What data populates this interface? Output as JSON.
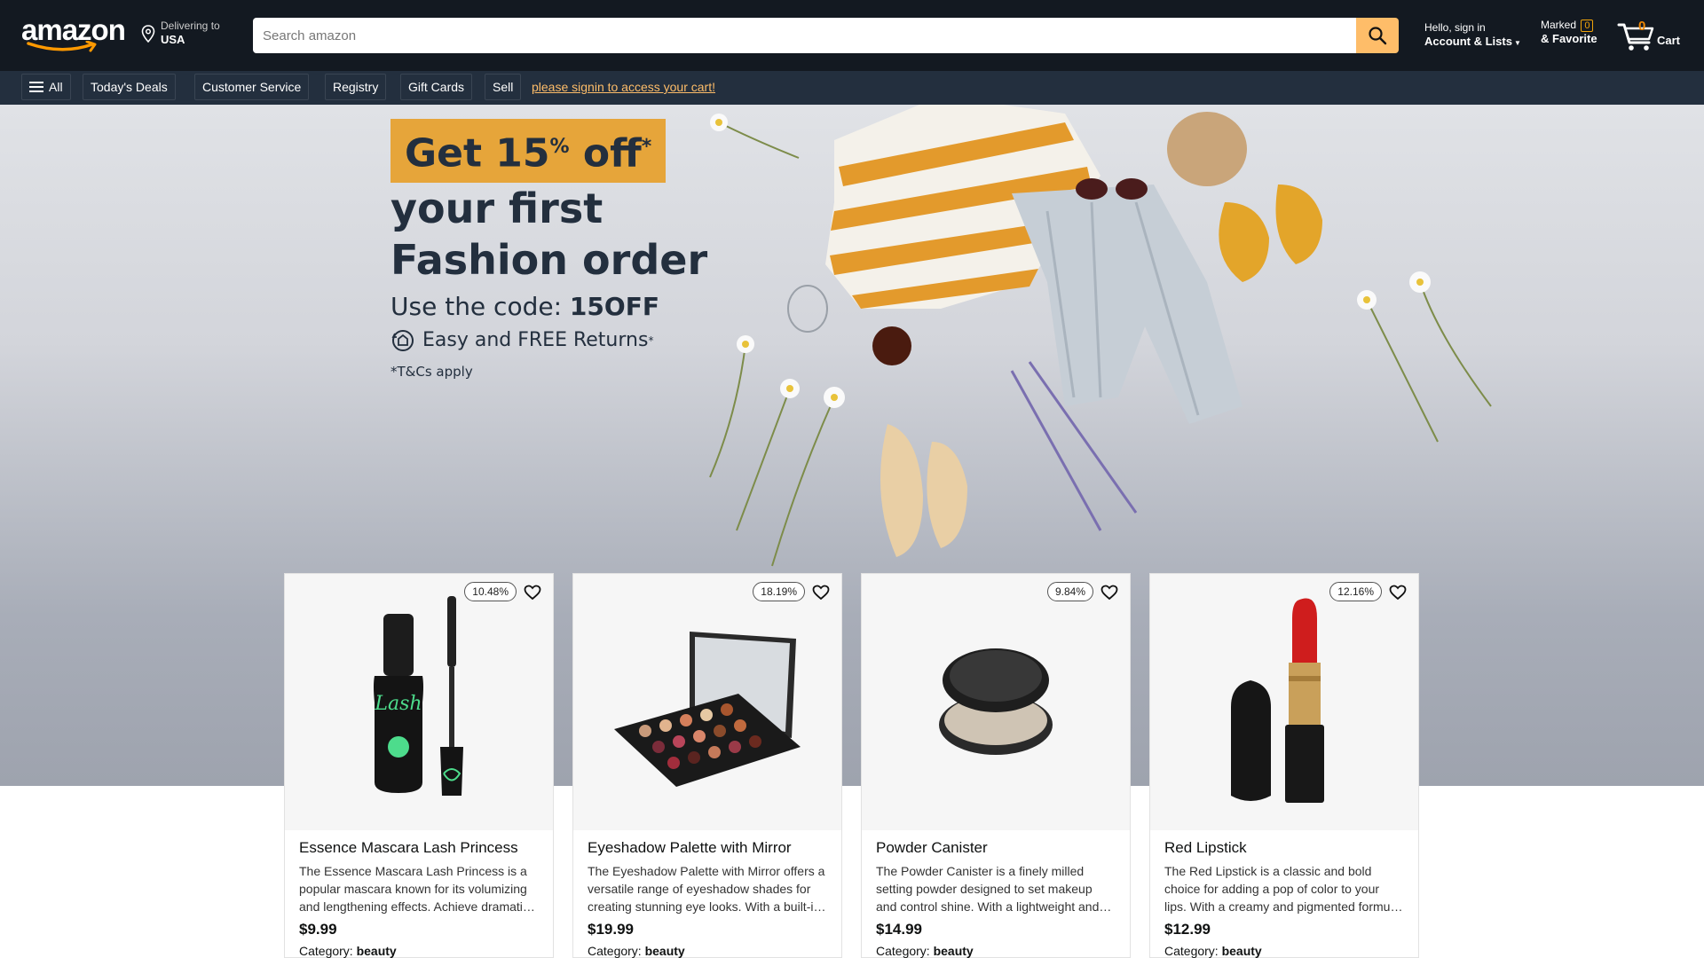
{
  "header": {
    "logo_text": "amazon",
    "deliver_label": "Delivering to",
    "deliver_location": "USA",
    "search_placeholder": "Search amazon",
    "account_greeting": "Hello, sign in",
    "account_label": "Account & Lists",
    "marked_label": "Marked",
    "marked_count": "0",
    "favorite_label": "& Favorite",
    "cart_count": "0",
    "cart_label": "Cart"
  },
  "subnav": {
    "all_label": "All",
    "items": [
      "Today's Deals",
      "Customer Service",
      "Registry",
      "Gift Cards",
      "Sell"
    ],
    "signin_prompt": "please signin to access your cart!"
  },
  "hero": {
    "offer": "Get 15",
    "offer_percent": "%",
    "offer_off": " off",
    "offer_star": "*",
    "line1": "your first",
    "line2": "Fashion order",
    "code_label": "Use the code: ",
    "code_value": "15OFF",
    "returns": "Easy and FREE Returns",
    "returns_star": "*",
    "terms": "*T&Cs apply"
  },
  "products": [
    {
      "title": "Essence Mascara Lash Princess",
      "description": "The Essence Mascara Lash Princess is a popular mascara known for its volumizing and lengthening effects. Achieve dramatic lashes with this long-lasting and cruelty-free formula.",
      "price": "$9.99",
      "category_label": "Category: ",
      "category": "beauty",
      "discount": "10.48%",
      "image": "mascara"
    },
    {
      "title": "Eyeshadow Palette with Mirror",
      "description": "The Eyeshadow Palette with Mirror offers a versatile range of eyeshadow shades for creating stunning eye looks. With a built-in mirror, it's convenient for on-the-go makeup application.",
      "price": "$19.99",
      "category_label": "Category: ",
      "category": "beauty",
      "discount": "18.19%",
      "image": "palette"
    },
    {
      "title": "Powder Canister",
      "description": "The Powder Canister is a finely milled setting powder designed to set makeup and control shine. With a lightweight and translucent formula, it provides a smooth and matte finish.",
      "price": "$14.99",
      "category_label": "Category: ",
      "category": "beauty",
      "discount": "9.84%",
      "image": "powder"
    },
    {
      "title": "Red Lipstick",
      "description": "The Red Lipstick is a classic and bold choice for adding a pop of color to your lips. With a creamy and pigmented formula, it provides a vibrant and long-lasting finish.",
      "price": "$12.99",
      "category_label": "Category: ",
      "category": "beauty",
      "discount": "12.16%",
      "image": "lipstick"
    }
  ],
  "colors": {
    "header_bg": "#131921",
    "subnav_bg": "#232f3e",
    "search_button": "#febd69",
    "promo_highlight": "#e6a53a",
    "link_yellow": "#febd69"
  },
  "icons": [
    "location-pin-icon",
    "search-icon",
    "cart-icon",
    "hamburger-icon",
    "heart-icon",
    "returns-icon"
  ]
}
